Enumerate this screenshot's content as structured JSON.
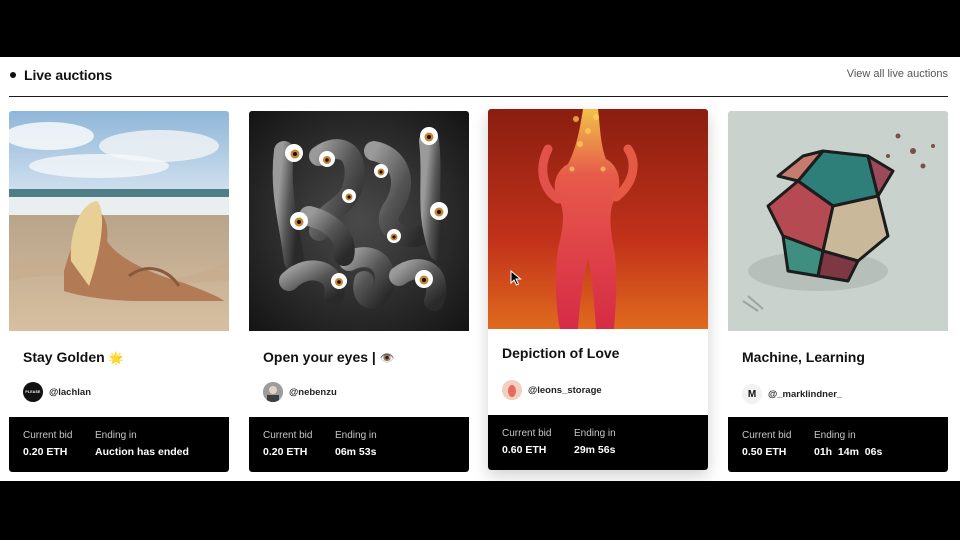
{
  "section": {
    "title": "Live auctions",
    "view_all_label": "View all live auctions"
  },
  "labels": {
    "current_bid": "Current bid",
    "ending_in": "Ending in"
  },
  "cards": [
    {
      "title": "Stay Golden",
      "emoji": "🌟",
      "creator": "@lachlan",
      "avatar_text": "PLEASE",
      "current_bid": "0.20 ETH",
      "ending": "Auction has ended"
    },
    {
      "title": "Open your eyes |",
      "emoji": "👁️",
      "creator": "@nebenzu",
      "current_bid": "0.20 ETH",
      "ending": "06m 53s"
    },
    {
      "title": "Depiction of Love",
      "creator": "@leons_storage",
      "current_bid": "0.60 ETH",
      "ending": "29m 56s"
    },
    {
      "title": "Machine, Learning",
      "creator": "@_marklindner_",
      "avatar_text": "M",
      "current_bid": "0.50 ETH",
      "ending": "01h  14m  06s"
    }
  ],
  "colors": {
    "background": "#000000",
    "panel": "#ffffff",
    "bid_bar": "#000000",
    "text": "#111111"
  },
  "icons": {
    "cursor": "mouse-pointer-icon"
  }
}
